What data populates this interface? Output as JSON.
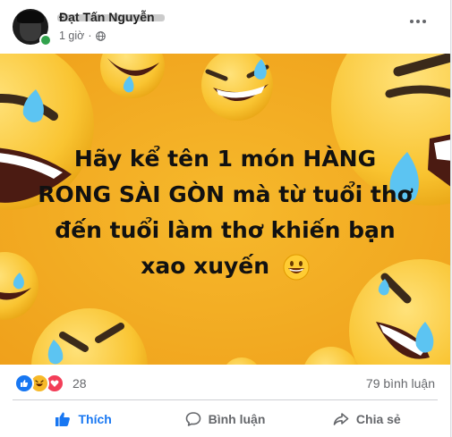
{
  "post": {
    "author": "Đạt Tấn Nguyễn",
    "time": "1 giờ",
    "image_text": [
      "Hãy kể tên 1 món HÀNG",
      "RONG SÀI GÒN mà từ tuổi thơ",
      "đến tuổi làm thơ khiến bạn",
      "xao xuyến"
    ],
    "image_background_color": "#f2b427"
  },
  "reactions": {
    "icons": [
      "like-icon",
      "haha-icon",
      "love-icon"
    ],
    "count": "28"
  },
  "comments": {
    "label": "79 bình luận"
  },
  "actions": {
    "like_label": "Thích",
    "comment_label": "Bình luận",
    "share_label": "Chia sẻ"
  },
  "colors": {
    "brand_blue": "#1877f2",
    "secondary_text": "#65676b",
    "online_green": "#31a24c"
  }
}
